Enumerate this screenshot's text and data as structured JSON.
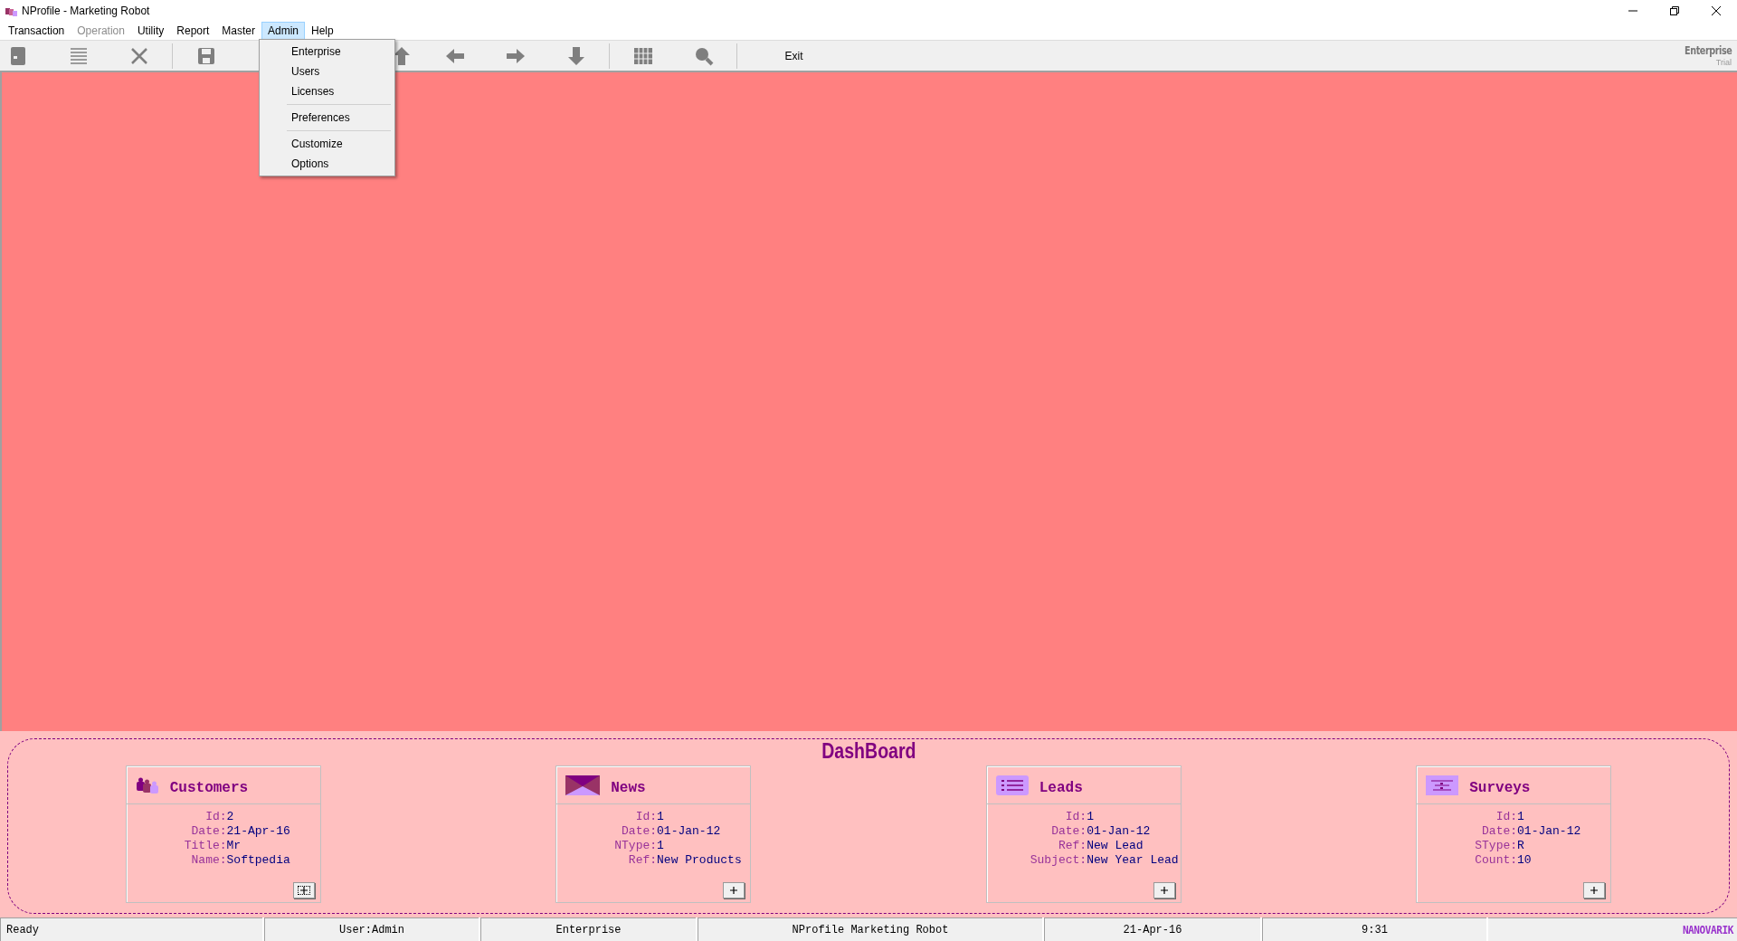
{
  "window": {
    "title": "NProfile - Marketing Robot"
  },
  "menu": [
    {
      "label": "Transaction",
      "disabled": false,
      "selected": false
    },
    {
      "label": "Operation",
      "disabled": true,
      "selected": false
    },
    {
      "label": "Utility",
      "disabled": false,
      "selected": false
    },
    {
      "label": "Report",
      "disabled": false,
      "selected": false
    },
    {
      "label": "Master",
      "disabled": false,
      "selected": false
    },
    {
      "label": "Admin",
      "disabled": false,
      "selected": true
    },
    {
      "label": "Help",
      "disabled": false,
      "selected": false
    }
  ],
  "admin_menu": [
    [
      "Enterprise",
      "Users",
      "Licenses"
    ],
    [
      "Preferences"
    ],
    [
      "Customize",
      "Options"
    ]
  ],
  "toolbar": {
    "exit_label": "Exit",
    "edition": "Enterprise",
    "license": "Trial"
  },
  "dashboard": {
    "title": "DashBoard",
    "cards": [
      {
        "kind": "customers",
        "title": "Customers",
        "focused": true,
        "fields": [
          {
            "label": "Id:",
            "value": "2"
          },
          {
            "label": "Date:",
            "value": "21-Apr-16"
          },
          {
            "label": "Title:",
            "value": "Mr"
          },
          {
            "label": "Name:",
            "value": "Softpedia"
          }
        ]
      },
      {
        "kind": "news",
        "title": "News",
        "focused": false,
        "fields": [
          {
            "label": "Id:",
            "value": "1"
          },
          {
            "label": "Date:",
            "value": "01-Jan-12"
          },
          {
            "label": "NType:",
            "value": "1"
          },
          {
            "label": "Ref:",
            "value": "New Products"
          }
        ]
      },
      {
        "kind": "leads",
        "title": "Leads",
        "focused": false,
        "fields": [
          {
            "label": "Id:",
            "value": "1"
          },
          {
            "label": "Date:",
            "value": "01-Jan-12"
          },
          {
            "label": "Ref:",
            "value": "New Lead"
          },
          {
            "label": "Subject:",
            "value": "New Year Lead"
          }
        ]
      },
      {
        "kind": "surveys",
        "title": "Surveys",
        "focused": false,
        "fields": [
          {
            "label": "Id:",
            "value": "1"
          },
          {
            "label": "Date:",
            "value": "01-Jan-12"
          },
          {
            "label": "SType:",
            "value": "R"
          },
          {
            "label": "Count:",
            "value": "10"
          }
        ]
      }
    ]
  },
  "status_bar": [
    "Ready",
    "User:Admin",
    "Enterprise",
    "NProfile Marketing Robot",
    "21-Apr-16",
    "9:31"
  ],
  "brand": "NANOVARIK"
}
